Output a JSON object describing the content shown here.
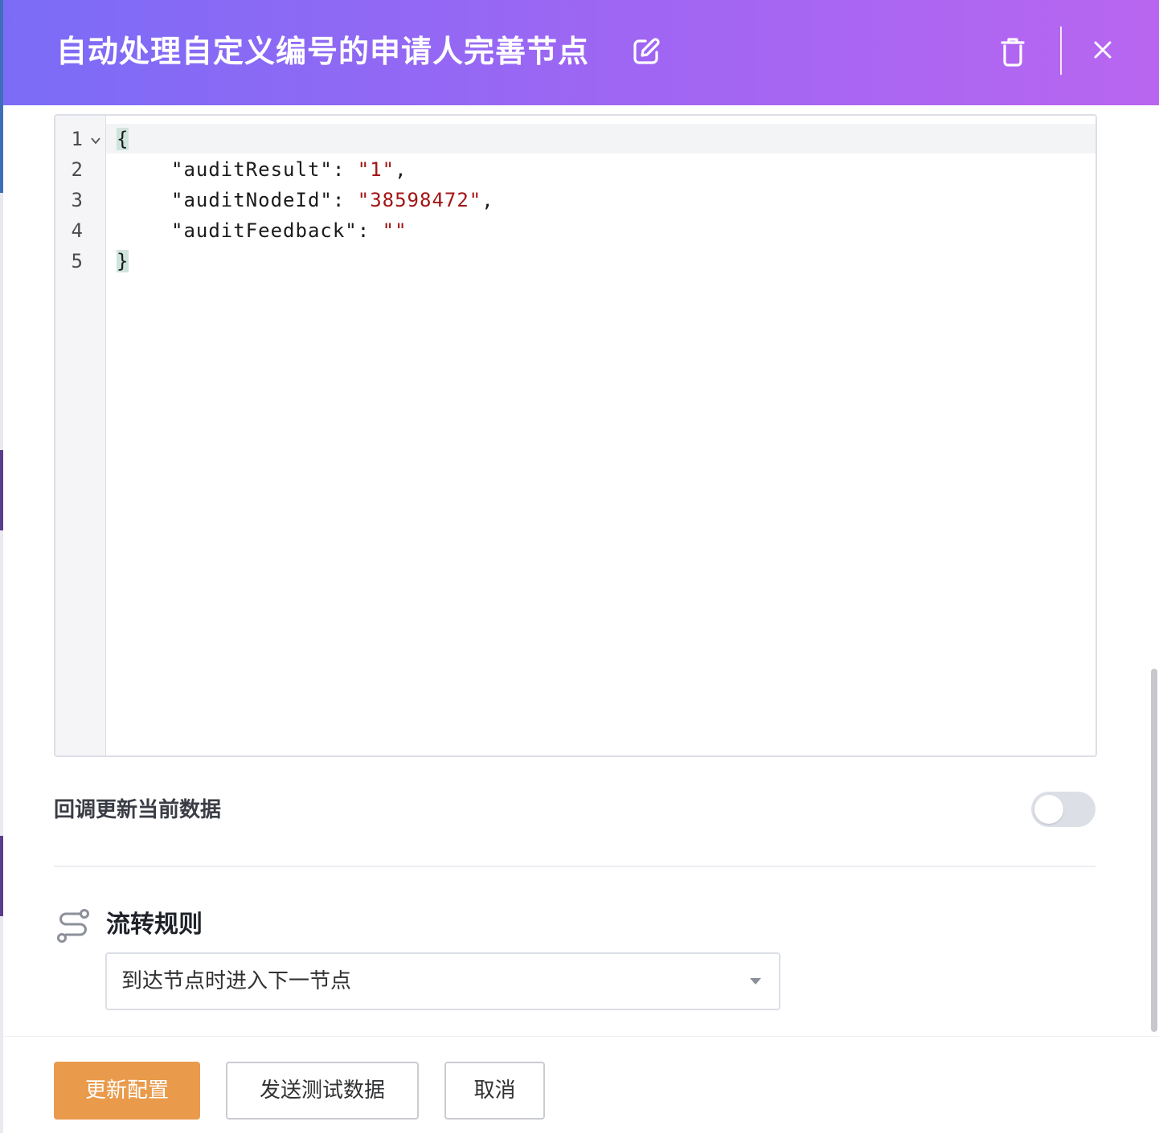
{
  "header": {
    "title": "自动处理自定义编号的申请人完善节点",
    "icons": [
      "edit-icon",
      "trash-icon",
      "close-icon"
    ]
  },
  "editor": {
    "line_numbers": [
      "1",
      "2",
      "3",
      "4",
      "5"
    ],
    "lines": {
      "l1": "{",
      "l2_key": "\"auditResult\": ",
      "l2_val": "\"1\"",
      "l2_end": ",",
      "l3_key": "\"auditNodeId\": ",
      "l3_val": "\"38598472\"",
      "l3_end": ",",
      "l4_key": "\"auditFeedback\": ",
      "l4_val": "\"\"",
      "l5": "}"
    },
    "string_color": "#a31515"
  },
  "callback": {
    "label": "回调更新当前数据",
    "enabled": false
  },
  "flow": {
    "title": "流转规则",
    "select_value": "到达节点时进入下一节点"
  },
  "footer": {
    "update_label": "更新配置",
    "test_label": "发送测试数据",
    "cancel_label": "取消"
  },
  "colors": {
    "header_gradient_start": "#7b6cf6",
    "header_gradient_end": "#b866f0",
    "primary_button": "#e99a4a"
  }
}
